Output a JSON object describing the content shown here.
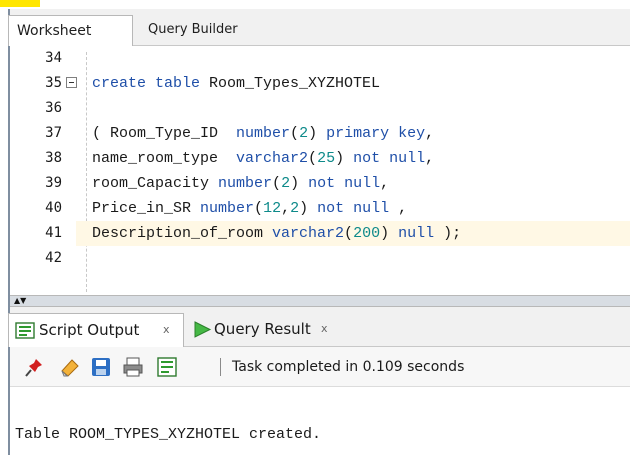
{
  "tabs": {
    "worksheet": "Worksheet",
    "query_builder": "Query Builder"
  },
  "editor": {
    "lines": [
      {
        "num": "34",
        "code": ""
      },
      {
        "num": "35",
        "code": "create table Room_Types_XYZHOTEL"
      },
      {
        "num": "36",
        "code": ""
      },
      {
        "num": "37",
        "code": "( Room_Type_ID  number(2) primary key,"
      },
      {
        "num": "38",
        "code": "name_room_type  varchar2(25) not null,"
      },
      {
        "num": "39",
        "code": "room_Capacity number(2) not null,"
      },
      {
        "num": "40",
        "code": "Price_in_SR number(12,2) not null ,"
      },
      {
        "num": "41",
        "code": "Description_of_room varchar2(200) null );"
      },
      {
        "num": "42",
        "code": ""
      }
    ],
    "highlight_line": "41"
  },
  "output_tabs": {
    "script_output": "Script Output",
    "query_result": "Query Result",
    "close_glyph": "x"
  },
  "toolbar": {
    "status": "Task completed in 0.109 seconds",
    "icons": [
      "pin-icon",
      "eraser-icon",
      "save-icon",
      "print-icon",
      "script-icon"
    ]
  },
  "output": {
    "text": "Table ROOM_TYPES_XYZHOTEL created."
  },
  "colors": {
    "keyword": "#1f4fa8",
    "number": "#0e8a8a",
    "highlight": "#fff8e5",
    "marker": "#ffe600"
  }
}
